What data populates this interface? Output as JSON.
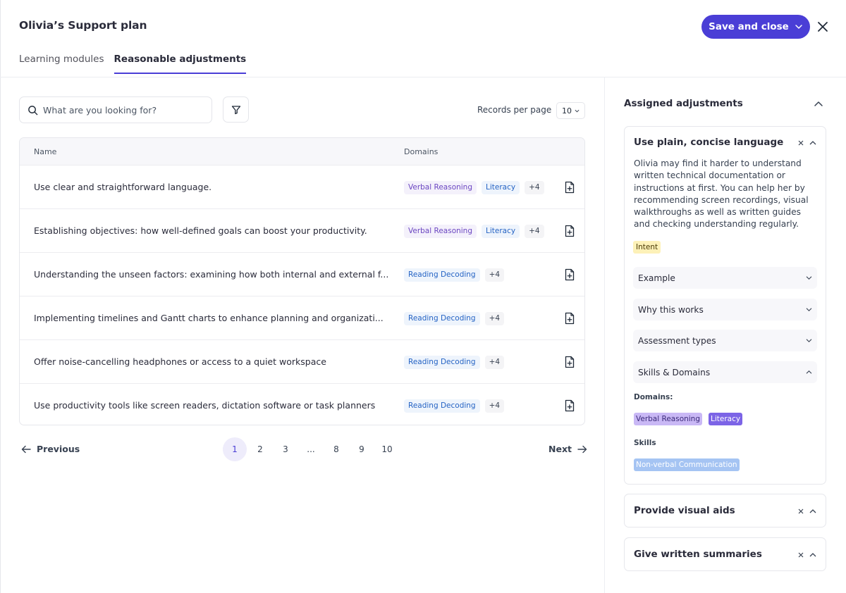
{
  "header": {
    "title": "Olivia’s Support plan",
    "save_label": "Save and close",
    "tabs": [
      {
        "label": "Learning modules",
        "active": false
      },
      {
        "label": "Reasonable adjustments",
        "active": true
      }
    ]
  },
  "toolbar": {
    "search_placeholder": "What are you looking for?",
    "records_per_page_label": "Records per page",
    "records_per_page_value": "10"
  },
  "table": {
    "columns": [
      "Name",
      "Domains"
    ],
    "rows": [
      {
        "name": "Use clear and straightforward language.",
        "chips": [
          {
            "label": "Verbal Reasoning",
            "kind": "verbal"
          },
          {
            "label": "Literacy",
            "kind": "literacy"
          },
          {
            "label": "+4",
            "kind": "more"
          }
        ]
      },
      {
        "name": "Establishing objectives: how well-defined goals can boost your productivity.",
        "chips": [
          {
            "label": "Verbal Reasoning",
            "kind": "verbal"
          },
          {
            "label": "Literacy",
            "kind": "literacy"
          },
          {
            "label": "+4",
            "kind": "more"
          }
        ]
      },
      {
        "name": "Understanding the unseen factors: examining how both internal and external f...",
        "chips": [
          {
            "label": "Reading Decoding",
            "kind": "reading"
          },
          {
            "label": "+4",
            "kind": "more"
          }
        ]
      },
      {
        "name": "Implementing timelines and Gantt charts to enhance planning and organizati...",
        "chips": [
          {
            "label": "Reading Decoding",
            "kind": "reading"
          },
          {
            "label": "+4",
            "kind": "more"
          }
        ]
      },
      {
        "name": "Offer noise-cancelling headphones or access to a quiet workspace",
        "chips": [
          {
            "label": "Reading Decoding",
            "kind": "reading"
          },
          {
            "label": "+4",
            "kind": "more"
          }
        ]
      },
      {
        "name": "Use productivity tools like screen readers, dictation software or task planners",
        "chips": [
          {
            "label": "Reading Decoding",
            "kind": "reading"
          },
          {
            "label": "+4",
            "kind": "more"
          }
        ]
      }
    ]
  },
  "pagination": {
    "previous_label": "Previous",
    "next_label": "Next",
    "pages": [
      "1",
      "2",
      "3",
      "...",
      "8",
      "9",
      "10"
    ],
    "current": "1"
  },
  "panel": {
    "title": "Assigned adjustments",
    "expanded_card": {
      "title": "Use plain, concise language",
      "description": "Olivia may find it harder to understand written technical documentation or instructions at first. You can help her by recommending screen recordings, visual walkthroughs as well as written guides and checking understanding regularly.",
      "tag": "Intent",
      "sections": [
        "Example",
        "Why this works",
        "Assessment types",
        "Skills & Domains"
      ],
      "domains_label": "Domains:",
      "domains": [
        "Verbal Reasoning",
        "Literacy"
      ],
      "skills_label": "Skills",
      "skills": [
        "Non-verbal Communication"
      ]
    },
    "collapsed_cards": [
      "Provide visual aids",
      "Give written summaries"
    ]
  },
  "colors": {
    "accent": "#4a3ed6",
    "verbal_chip": "#6b46c1",
    "literacy_chip": "#2563c4",
    "intent_tag": "#fdf1b8",
    "domain_tag_purple": "#c9b8f5",
    "domain_tag_violet": "#7c64e6",
    "skill_tag_blue": "#a5c4f3"
  }
}
